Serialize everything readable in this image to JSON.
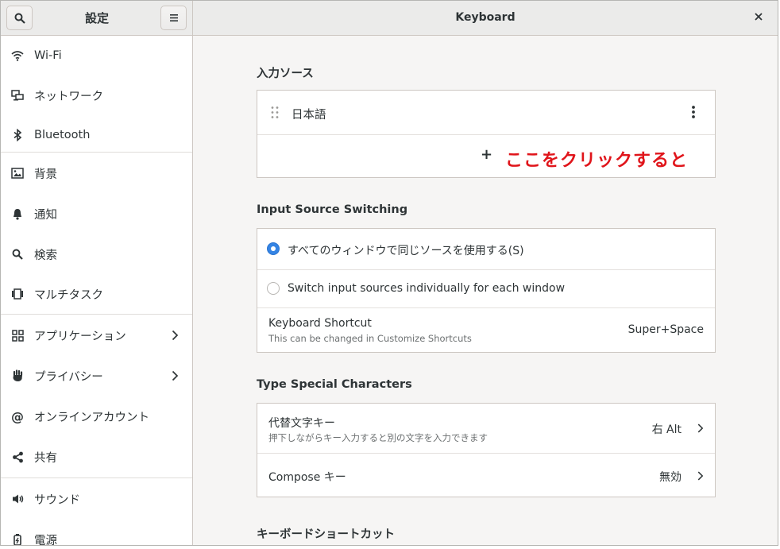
{
  "sidebar": {
    "title": "設定",
    "items": [
      {
        "label": "Wi-Fi",
        "icon": "wifi-icon"
      },
      {
        "label": "ネットワーク",
        "icon": "network-icon"
      },
      {
        "label": "Bluetooth",
        "icon": "bluetooth-icon"
      },
      {
        "label": "背景",
        "icon": "background-icon"
      },
      {
        "label": "通知",
        "icon": "bell-icon"
      },
      {
        "label": "検索",
        "icon": "search-icon"
      },
      {
        "label": "マルチタスク",
        "icon": "multitasking-icon"
      },
      {
        "label": "アプリケーション",
        "icon": "apps-grid-icon"
      },
      {
        "label": "プライバシー",
        "icon": "hand-icon"
      },
      {
        "label": "オンラインアカウント",
        "icon": "at-sign-icon"
      },
      {
        "label": "共有",
        "icon": "share-icon"
      },
      {
        "label": "サウンド",
        "icon": "speaker-icon"
      },
      {
        "label": "電源",
        "icon": "power-icon"
      }
    ]
  },
  "header": {
    "title": "Keyboard"
  },
  "input_sources": {
    "title": "入力ソース",
    "items": [
      {
        "label": "日本語"
      }
    ],
    "add_symbol": "+",
    "annotation": "ここをクリックすると"
  },
  "switching": {
    "title": "Input Source Switching",
    "option_same": "すべてのウィンドウで同じソースを使用する(S)",
    "option_individual": "Switch input sources individually for each window",
    "selected": "same",
    "shortcut_label": "Keyboard Shortcut",
    "shortcut_hint": "This can be changed in Customize Shortcuts",
    "shortcut_value": "Super+Space"
  },
  "special_chars": {
    "title": "Type Special Characters",
    "alt_label": "代替文字キー",
    "alt_hint": "押下しながらキー入力すると別の文字を入力できます",
    "alt_value": "右 Alt",
    "compose_label": "Compose キー",
    "compose_value": "無効"
  },
  "shortcuts": {
    "title": "キーボードショートカット"
  },
  "colors": {
    "accent": "#3584e4",
    "annotation": "#e0151b"
  }
}
